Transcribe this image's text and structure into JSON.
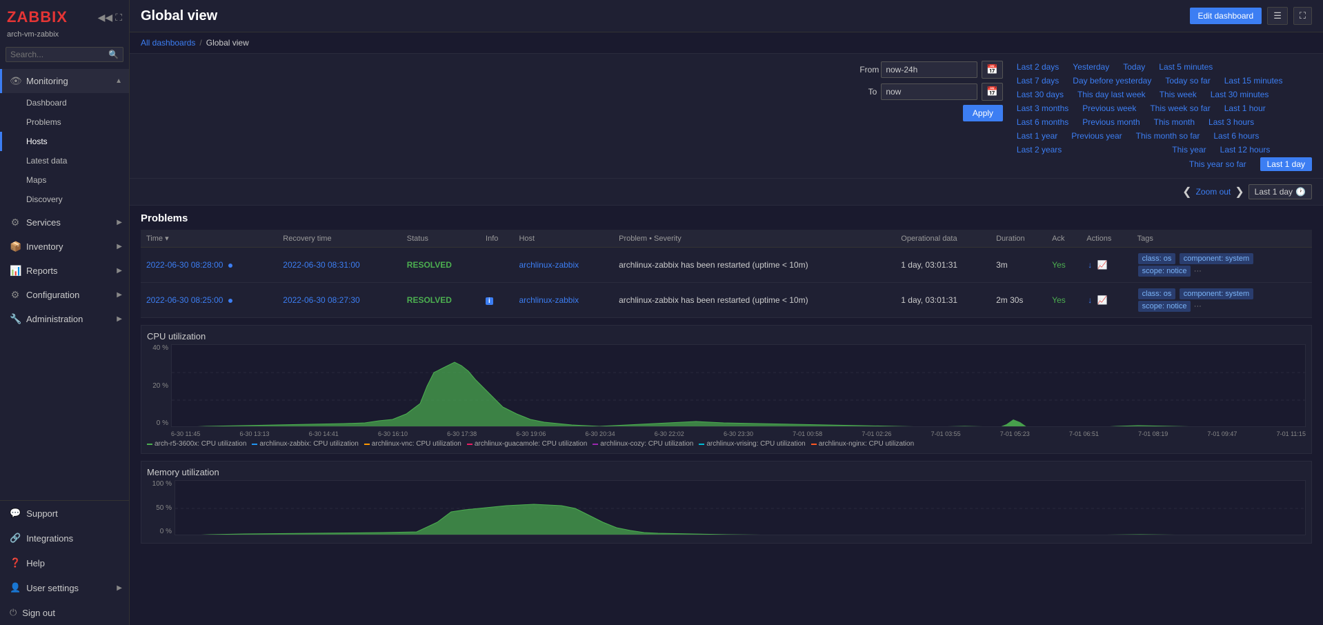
{
  "app": {
    "logo": "ZABBIX",
    "hostname": "arch-vm-zabbix"
  },
  "sidebar": {
    "search_placeholder": "Search...",
    "nav_items": [
      {
        "id": "monitoring",
        "label": "Monitoring",
        "icon": "👁",
        "expanded": true
      },
      {
        "id": "dashboard",
        "label": "Dashboard",
        "sub": true,
        "active": false
      },
      {
        "id": "problems",
        "label": "Problems",
        "sub": true
      },
      {
        "id": "hosts",
        "label": "Hosts",
        "sub": true,
        "active": true
      },
      {
        "id": "latest-data",
        "label": "Latest data",
        "sub": true
      },
      {
        "id": "maps",
        "label": "Maps",
        "sub": true
      },
      {
        "id": "discovery",
        "label": "Discovery",
        "sub": true
      },
      {
        "id": "services",
        "label": "Services",
        "icon": "⚙",
        "top": true
      },
      {
        "id": "inventory",
        "label": "Inventory",
        "icon": "📦",
        "top": true
      },
      {
        "id": "reports",
        "label": "Reports",
        "icon": "📊",
        "top": true
      },
      {
        "id": "configuration",
        "label": "Configuration",
        "icon": "⚙",
        "top": true
      },
      {
        "id": "administration",
        "label": "Administration",
        "icon": "🔧",
        "top": true
      }
    ],
    "bottom_items": [
      {
        "id": "support",
        "label": "Support",
        "icon": "💬"
      },
      {
        "id": "integrations",
        "label": "Integrations",
        "icon": "🔗"
      },
      {
        "id": "help",
        "label": "Help",
        "icon": "❓"
      },
      {
        "id": "user-settings",
        "label": "User settings",
        "icon": "👤"
      },
      {
        "id": "sign-out",
        "label": "Sign out",
        "icon": "⏻"
      }
    ]
  },
  "header": {
    "title": "Global view",
    "edit_dashboard_label": "Edit dashboard",
    "breadcrumb_all": "All dashboards",
    "breadcrumb_current": "Global view"
  },
  "time_range": {
    "from_label": "From",
    "to_label": "To",
    "from_value": "now-24h",
    "to_value": "now",
    "apply_label": "Apply",
    "zoom_out_label": "Zoom out",
    "last_day_label": "Last 1 day",
    "quick_ranges": [
      [
        "Last 2 days",
        "Yesterday",
        "Today",
        "Last 5 minutes"
      ],
      [
        "Last 7 days",
        "Day before yesterday",
        "Today so far",
        "Last 15 minutes"
      ],
      [
        "Last 30 days",
        "This day last week",
        "This week",
        "Last 30 minutes"
      ],
      [
        "Last 3 months",
        "Previous week",
        "This week so far",
        "Last 1 hour"
      ],
      [
        "Last 6 months",
        "Previous month",
        "This month",
        "Last 3 hours"
      ],
      [
        "Last 1 year",
        "Previous year",
        "This month so far",
        "Last 6 hours"
      ],
      [
        "Last 2 years",
        "",
        "This year",
        "Last 12 hours"
      ],
      [
        "",
        "",
        "This year so far",
        "Last 1 day"
      ]
    ]
  },
  "problems": {
    "section_title": "Problems",
    "columns": [
      "Time",
      "Recovery time",
      "Status",
      "Info",
      "Host",
      "Problem • Severity",
      "Operational data",
      "Duration",
      "Ack",
      "Actions",
      "Tags"
    ],
    "rows": [
      {
        "time": "2022-06-30 08:28:00",
        "recovery": "2022-06-30 08:31:00",
        "status": "RESOLVED",
        "info": "",
        "host": "archlinux-zabbix",
        "problem": "archlinux-zabbix has been restarted (uptime < 10m)",
        "op_data": "1 day, 03:01:31",
        "duration": "3m",
        "ack": "Yes",
        "tags": [
          "class: os",
          "component: system",
          "scope: notice"
        ]
      },
      {
        "time": "2022-06-30 08:25:00",
        "recovery": "2022-06-30 08:27:30",
        "status": "RESOLVED",
        "info": "i",
        "host": "archlinux-zabbix",
        "problem": "archlinux-zabbix has been restarted (uptime < 10m)",
        "op_data": "1 day, 03:01:31",
        "duration": "2m 30s",
        "ack": "Yes",
        "tags": [
          "class: os",
          "component: system",
          "scope: notice"
        ]
      }
    ]
  },
  "cpu_chart": {
    "title": "CPU utilization",
    "y_max": "40 %",
    "y_mid": "20 %",
    "y_min": "0 %",
    "x_labels": [
      "6-30 11:45",
      "6-30 13:13",
      "6-30 14:41",
      "6-30 16:10",
      "6-30 17:38",
      "6-30 19:06",
      "6-30 20:34",
      "6-30 22:02",
      "6-30 23:30",
      "7-01 00:58",
      "7-01 02:26",
      "7-01 03:55",
      "7-01 05:23",
      "7-01 06:51",
      "7-01 08:19",
      "7-01 09:47",
      "7-01 11:15"
    ],
    "legend": [
      {
        "label": "arch-r5-3600x: CPU utilization",
        "color": "#4caf50"
      },
      {
        "label": "archlinux-zabbix: CPU utilization",
        "color": "#2196f3"
      },
      {
        "label": "archlinux-vnc: CPU utilization",
        "color": "#ff9800"
      },
      {
        "label": "archlinux-guacamole: CPU utilization",
        "color": "#e91e63"
      },
      {
        "label": "archlinux-cozy: CPU utilization",
        "color": "#9c27b0"
      },
      {
        "label": "archlinux-vrising: CPU utilization",
        "color": "#00bcd4"
      },
      {
        "label": "archlinux-nginx: CPU utilization",
        "color": "#ff5722"
      }
    ]
  },
  "memory_chart": {
    "title": "Memory utilization",
    "y_max": "100 %",
    "y_mid": "50 %",
    "y_min": "0 %"
  }
}
